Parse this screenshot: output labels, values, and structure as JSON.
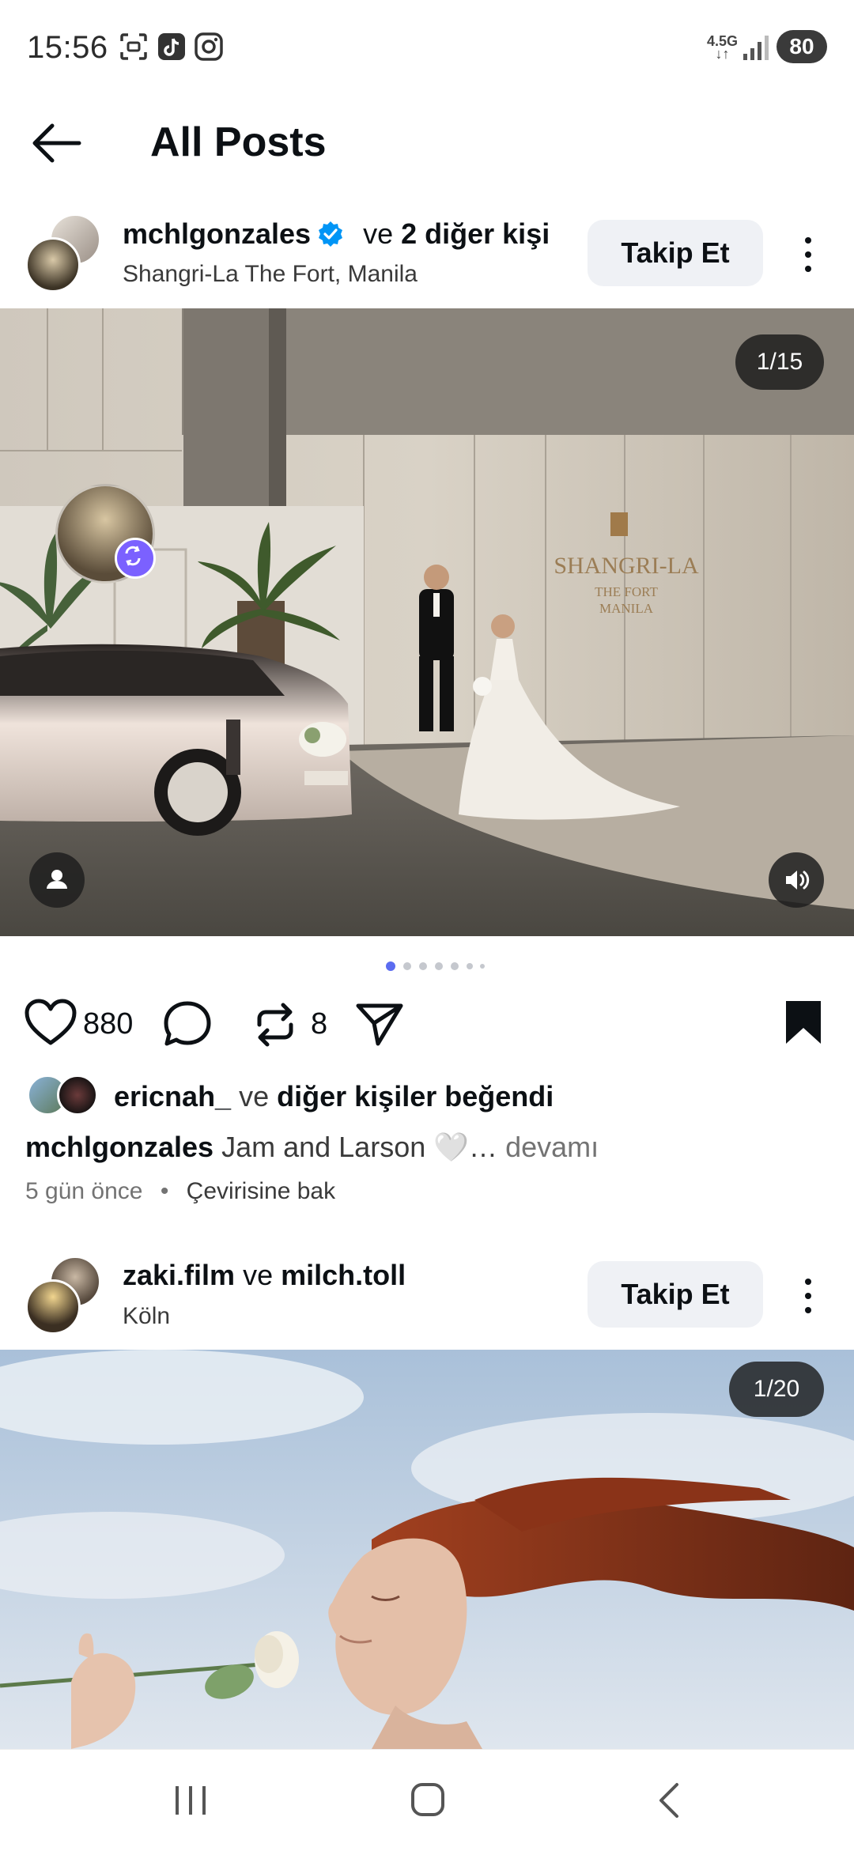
{
  "status_bar": {
    "time": "15:56",
    "network": "4.5G",
    "battery": "80",
    "icons": [
      "screenshot-icon",
      "tiktok-icon",
      "instagram-icon",
      "signal-icon"
    ]
  },
  "header": {
    "title": "All Posts",
    "back_icon": "arrow-left-icon"
  },
  "post1": {
    "username": "mchlgonzales",
    "verified": true,
    "connector": "ve",
    "others": "2 diğer kişi",
    "location": "Shangri-La The Fort, Manila",
    "follow_label": "Takip Et",
    "counter": "1/15",
    "sign_line1": "SHANGRI-LA",
    "sign_line2": "THE FORT",
    "sign_line3": "MANILA",
    "likes": "880",
    "reposts": "8",
    "liked_by_user": "ericnah_",
    "liked_by_connector": "ve",
    "liked_by_rest": "diğer kişiler beğendi",
    "caption_user": "mchlgonzales",
    "caption_text": "Jam and Larson 🤍…",
    "more_label": "devamı",
    "time_ago": "5 gün önce",
    "separator": "•",
    "translate_label": "Çevirisine bak",
    "page_dots": 7,
    "active_dot": 0
  },
  "post2": {
    "username": "zaki.film",
    "connector": "ve",
    "coauthor": "milch.toll",
    "location": "Köln",
    "follow_label": "Takip Et",
    "counter": "1/20"
  },
  "colors": {
    "accent": "#0095f6",
    "verified": "#0095f6",
    "repost_badge": "#7b61ff",
    "dot_active": "#5b6cf0",
    "dot_inactive": "#c5c8ce"
  },
  "nav_bar": {
    "icons": [
      "recents-icon",
      "home-icon",
      "back-icon"
    ]
  }
}
